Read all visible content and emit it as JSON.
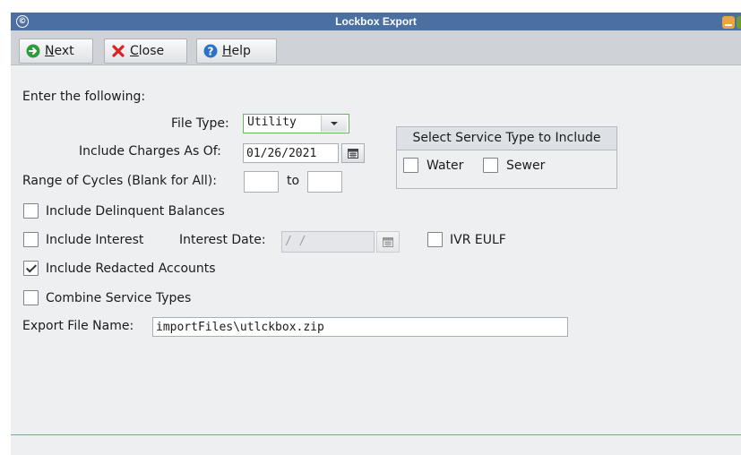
{
  "window": {
    "title": "Lockbox Export"
  },
  "toolbar": {
    "next_mnemonic": "N",
    "next_rest": "ext",
    "close_mnemonic": "C",
    "close_rest": "lose",
    "help_mnemonic": "H",
    "help_rest": "elp"
  },
  "form": {
    "instructions": "Enter the following:",
    "file_type_label": "File Type:",
    "file_type_value": "Utility",
    "charges_label": "Include Charges As Of:",
    "charges_date": "01/26/2021",
    "cycles_label": "Range of Cycles (Blank for All):",
    "cycles_from": "",
    "cycles_to_label": "to",
    "cycles_to": "",
    "delinquent_label": "Include Delinquent Balances",
    "interest_label": "Include Interest",
    "interest_date_label": "Interest Date:",
    "interest_date_value": "  /  /",
    "ivr_label": "IVR EULF",
    "redacted_label": "Include Redacted Accounts",
    "combine_label": "Combine Service Types",
    "export_label": "Export File Name:",
    "export_value": "importFiles\\utlckbox.zip"
  },
  "service_group": {
    "title": "Select Service Type to Include",
    "water_label": "Water",
    "sewer_label": "Sewer"
  },
  "checkbox_states": {
    "delinquent": false,
    "interest": false,
    "ivr_eulf": false,
    "redacted": true,
    "combine": false,
    "water": false,
    "sewer": false
  },
  "colors": {
    "titlebar": "#4b6fa1",
    "toolbar": "#cfd3d8",
    "body": "#eeeff1",
    "next_icon": "#2e9b3f",
    "close_icon": "#e02020",
    "help_icon": "#2c72c7",
    "select_border": "#69b35b"
  },
  "icons": {
    "next": "arrow-right-circle-icon",
    "close": "x-mark-icon",
    "help": "question-circle-icon",
    "calendar": "calendar-icon",
    "dropdown": "chevron-down-icon"
  }
}
